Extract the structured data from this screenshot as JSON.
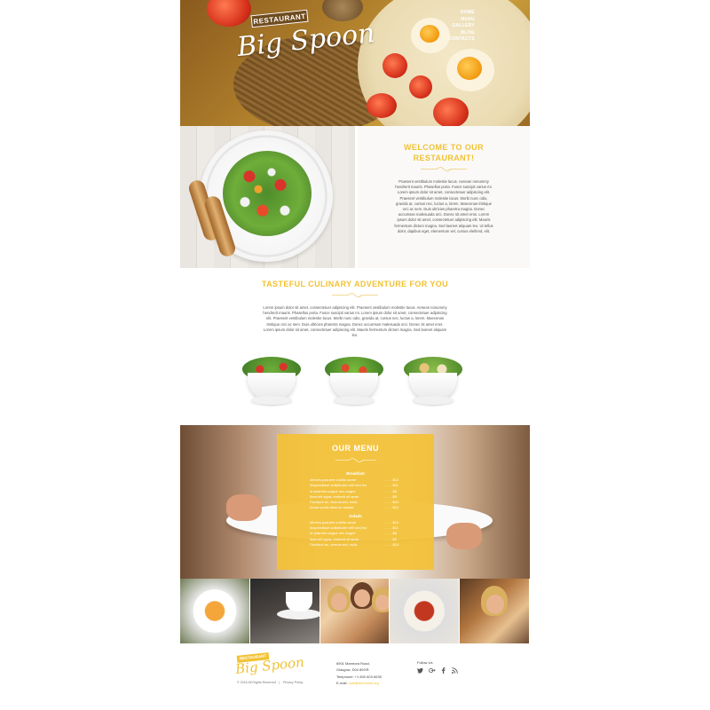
{
  "hero": {
    "badge": "RESTAURANT",
    "logo": "Big Spoon",
    "nav": [
      {
        "label": "HOME"
      },
      {
        "label": "MENU"
      },
      {
        "label": "GALLERY"
      },
      {
        "label": "BLOG"
      },
      {
        "label": "CONTACTS"
      }
    ]
  },
  "welcome": {
    "title": "WELCOME TO OUR RESTAURANT!",
    "text": "Praesent vestibulum molestie lacus. Aenean nonummy hendrerit mauris. Phasellus porta. Fusce suscipit varius mi. Lorem ipsum dolor sit amet, consectetuer adipiscing elit. Praesent vestibulum molestie lacus. Morbi nunc odio, gravida at, cursus nec, luctus a, lorem. Maecenas tristique orci ac sem. Duis ultricies pharetra magna. Donec accumsan malesuada orci. Donec sit amet eros. Lorem ipsum dolor sit amet, consectetuer adipiscing elit. Mauris fermentum dictum magna. Sed laoreet aliquam leo. Ut tellus dolor, dapibus eget, elementum vel, cursus eleifend, elit."
  },
  "adventure": {
    "title": "TASTEFUL CULINARY ADVENTURE FOR YOU",
    "text": "Lorem ipsum dolor sit amet, consectetuer adipiscing elit. Praesent vestibulum molestie lacus. Aenean nonummy hendrerit mauris. Phasellus porta. Fusce suscipit varius mi. Lorem ipsum dolor sit amet, consectetuer adipiscing elit. Praesent vestibulum molestie lacus. Morbi nunc odio, gravida at, cursus nec, luctus a, lorem. Maecenas tristique orci ac sem. Duis ultricies pharetra magna. Donec accumsan malesuada orci. Donec sit amet eros. Lorem ipsum dolor sit amet, consectetuer adipiscing elit. Mauris fermentum dictum magna. Sed laoreet aliquam leo."
  },
  "menu": {
    "title": "OUR MENU",
    "categories": [
      {
        "name": "Breakfast",
        "items": [
          {
            "name": "Ultrices posuere cubilia curae",
            "price": "$12"
          },
          {
            "name": "Suspendisse sollicitudin velit sed leo",
            "price": "$11"
          },
          {
            "name": "Ut pharetra augue nec augue",
            "price": "$8"
          },
          {
            "name": "Nam elit agna, endrerit sit amet",
            "price": "$9"
          },
          {
            "name": "Tincidunt ac, viverra sed, nulla",
            "price": "$10"
          },
          {
            "name": "Donec porta diam eu massa",
            "price": "$12"
          }
        ]
      },
      {
        "name": "Salads",
        "items": [
          {
            "name": "Ultrices posuere cubilia curae",
            "price": "$12"
          },
          {
            "name": "Suspendisse sollicitudin velit sed leo",
            "price": "$11"
          },
          {
            "name": "Ut pharetra augue nec augue",
            "price": "$8"
          },
          {
            "name": "Nam elit agna, endrerit sit amet",
            "price": "$9"
          },
          {
            "name": "Tincidunt ac, viverra sed, nulla",
            "price": "$10"
          }
        ]
      }
    ]
  },
  "footer": {
    "badge": "RESTAURANT",
    "logo": "Big Spoon",
    "copyright": "© 2016 All Rights Reserved",
    "privacy": "Privacy Policy",
    "address_line1": "8901 Marmora Road,",
    "address_line2": "Glasgow, D04 89GR.",
    "telephone": "Telephone: +1 800 603 6035",
    "email_label": "E-mail:",
    "email": "mail@demolink.org",
    "follow": "Follow Us"
  },
  "colors": {
    "accent": "#f1c232",
    "hero_brown": "#9c6a25"
  },
  "icons": {
    "social": [
      "twitter-icon",
      "google-plus-icon",
      "facebook-icon",
      "rss-icon"
    ]
  }
}
